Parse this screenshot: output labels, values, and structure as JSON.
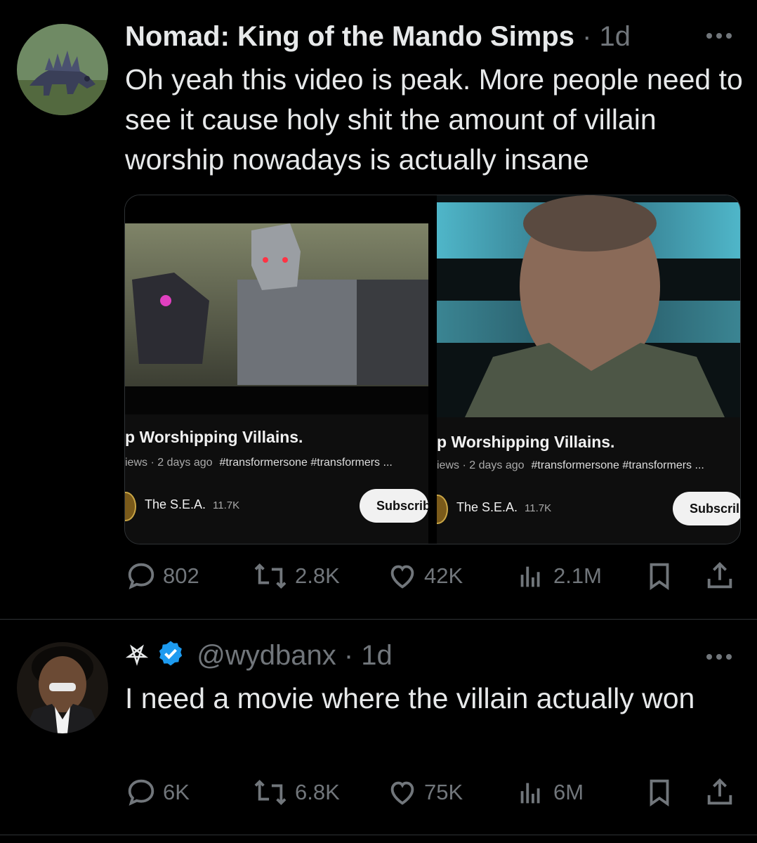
{
  "tweet1": {
    "author_name": "Nomad: King of the Mando Simps",
    "time": "· 1d",
    "text": "Oh yeah this video is peak. More people need to see it cause holy shit the amount of villain worship nowadays is actually insane",
    "media": {
      "left": {
        "title": "p Worshipping Villains.",
        "meta": "iews · 2 days ago",
        "tags": "#transformersone #transformers ...",
        "channel": "The S.E.A.",
        "subs": "11.7K",
        "subscribe": "Subscrib"
      },
      "right": {
        "title": "p Worshipping Villains.",
        "meta": "iews · 2 days ago",
        "tags": "#transformersone #transformers ...",
        "channel": "The S.E.A.",
        "subs": "11.7K",
        "subscribe": "Subscril"
      }
    },
    "actions": {
      "replies": "802",
      "reposts": "2.8K",
      "likes": "42K",
      "views": "2.1M"
    }
  },
  "tweet2": {
    "handle": "@wydbanx",
    "time": "· 1d",
    "text": "I need a movie where the villain actually won",
    "actions": {
      "replies": "6K",
      "reposts": "6.8K",
      "likes": "75K",
      "views": "6M"
    }
  },
  "colors": {
    "background": "#000000",
    "text": "#e7e9ea",
    "muted": "#71767b",
    "verified": "#1d9bf0"
  }
}
